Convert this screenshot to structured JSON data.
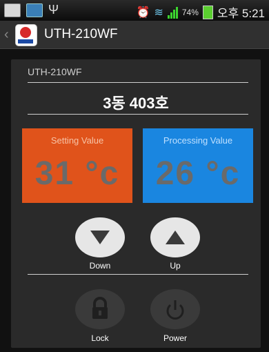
{
  "statusbar": {
    "battery_pct": "74%",
    "time": "오후 5:21",
    "icons": [
      "image-icon",
      "photo-icon",
      "usb-icon",
      "alarm-icon",
      "wifi-icon",
      "signal-icon",
      "battery-icon"
    ]
  },
  "actionbar": {
    "title": "UTH-210WF"
  },
  "panel": {
    "device_name": "UTH-210WF",
    "room": "3동 403호",
    "setting": {
      "label": "Setting Value",
      "value": "31 °c"
    },
    "processing": {
      "label": "Processing Value",
      "value": "26 °c"
    },
    "buttons": {
      "down": "Down",
      "up": "Up",
      "lock": "Lock",
      "power": "Power"
    }
  },
  "colors": {
    "setting_card": "#e0531b",
    "processing_card": "#1a86e0",
    "panel": "#2a2a2a"
  }
}
